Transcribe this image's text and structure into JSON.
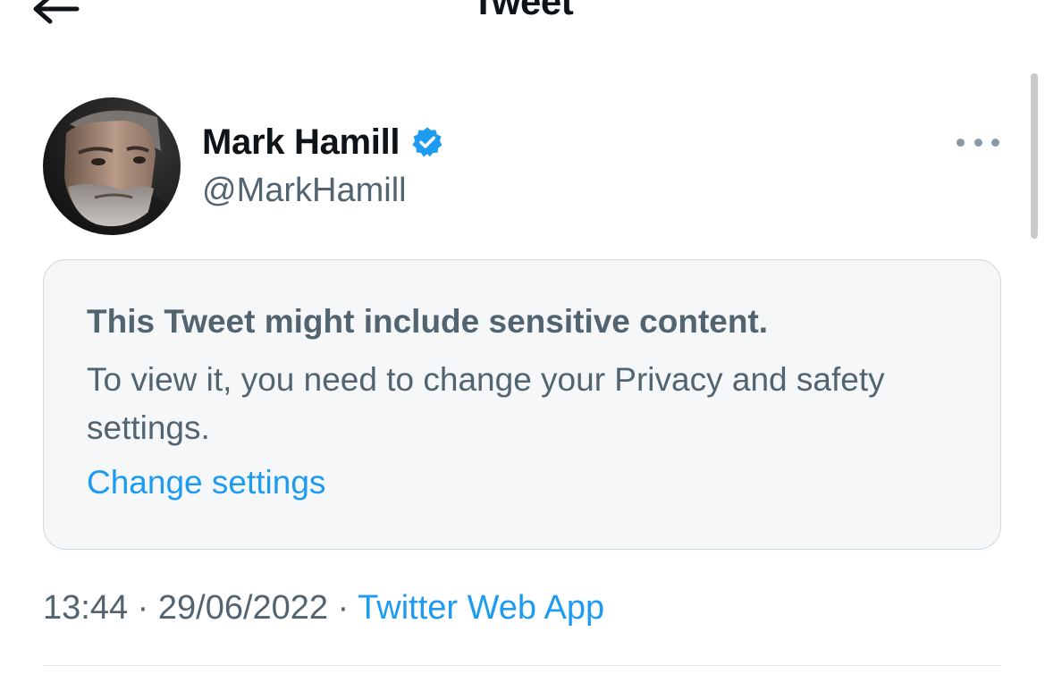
{
  "header": {
    "title": "Tweet",
    "back_icon": "arrow-left-icon"
  },
  "tweet": {
    "author": {
      "name": "Mark Hamill",
      "handle": "@MarkHamill",
      "verified": true,
      "verified_icon": "verified-badge-icon",
      "avatar_icon": "avatar-photo"
    },
    "more_icon": "more-horizontal-icon",
    "notice": {
      "title": "This Tweet might include sensitive content.",
      "body": "To view it, you need to change your Privacy and safety settings.",
      "link": "Change settings"
    },
    "meta": {
      "time": "13:44",
      "separator": " · ",
      "date": "29/06/2022",
      "source": "Twitter Web App"
    }
  },
  "colors": {
    "text_primary": "#0f1419",
    "text_secondary": "#536471",
    "link": "#1d9bf0",
    "verified": "#1d9bf0",
    "card_background": "#f5f7f8",
    "card_border": "#cfd9de"
  }
}
